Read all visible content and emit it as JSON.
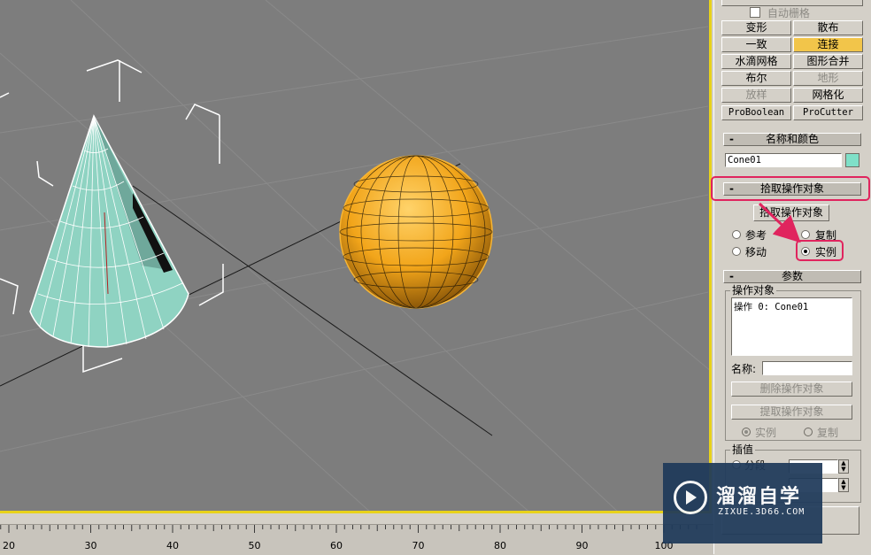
{
  "compound_objects": {
    "autogrid_label": "自动栅格",
    "buttons": [
      {
        "label": "变形",
        "state": "normal"
      },
      {
        "label": "散布",
        "state": "normal"
      },
      {
        "label": "一致",
        "state": "normal"
      },
      {
        "label": "连接",
        "state": "active"
      },
      {
        "label": "水滴网格",
        "state": "normal"
      },
      {
        "label": "图形合并",
        "state": "normal"
      },
      {
        "label": "布尔",
        "state": "normal"
      },
      {
        "label": "地形",
        "state": "disabled"
      },
      {
        "label": "放样",
        "state": "disabled"
      },
      {
        "label": "网格化",
        "state": "normal"
      },
      {
        "label": "ProBoolean",
        "state": "normal"
      },
      {
        "label": "ProCutter",
        "state": "normal"
      }
    ]
  },
  "name_color": {
    "title": "名称和颜色",
    "object_name": "Cone01",
    "swatch_color": "#7fe0c8"
  },
  "pick_operand": {
    "title": "拾取操作对象",
    "button_label": "拾取操作对象",
    "options": {
      "reference": "参考",
      "copy": "复制",
      "move": "移动",
      "instance": "实例"
    },
    "selected": "instance"
  },
  "parameters": {
    "title": "参数",
    "operands_group": "操作对象",
    "operands": [
      "操作 0: Cone01"
    ],
    "name_label": "名称:",
    "name_value": "",
    "delete_button": "删除操作对象",
    "extract_button": "提取操作对象",
    "extract_instance": "实例",
    "extract_copy": "复制",
    "interpolation_group": "插值",
    "segments_label": "分段"
  },
  "timeline": {
    "ticks": [
      20,
      30,
      40,
      50,
      60,
      70,
      80,
      90,
      100
    ]
  },
  "watermark": {
    "title": "溜溜自学",
    "subtitle": "ZIXUE.3D66.COM"
  },
  "colors": {
    "viewport_bg": "#7d7d7d",
    "cone": "#8fd3c2",
    "sphere": "#f2a51a",
    "active_button": "#f2c54a",
    "highlight": "#e0245e",
    "viewport_border": "#e8d21a"
  }
}
